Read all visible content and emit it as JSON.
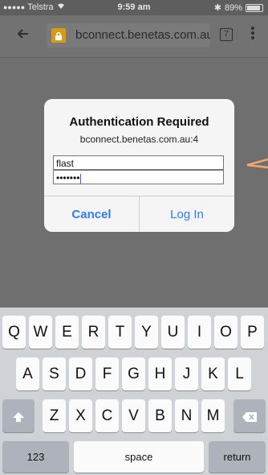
{
  "status_bar": {
    "signal": "●●●●●",
    "carrier": "Telstra",
    "time": "9:59 am",
    "battery_percent": "89%",
    "battery_level": 0.89
  },
  "browser": {
    "back_icon": "arrow-left-icon",
    "lock_icon": "lock-icon",
    "url": "bconnect.benetas.com.au",
    "tab_count": "7",
    "menu_icon": "more-vert-icon"
  },
  "dialog": {
    "title": "Authentication Required",
    "host": "bconnect.benetas.com.au:4",
    "username_value": "flast",
    "password_value": "•••••••",
    "cancel_label": "Cancel",
    "login_label": "Log In"
  },
  "keyboard": {
    "row1": [
      "Q",
      "W",
      "E",
      "R",
      "T",
      "Y",
      "U",
      "I",
      "O",
      "P"
    ],
    "row2": [
      "A",
      "S",
      "D",
      "F",
      "G",
      "H",
      "J",
      "K",
      "L"
    ],
    "row3": [
      "Z",
      "X",
      "C",
      "V",
      "B",
      "N",
      "M"
    ],
    "shift_icon": "shift-icon",
    "delete_icon": "backspace-icon",
    "numbers_label": "123",
    "space_label": "space",
    "return_label": "return"
  },
  "colors": {
    "accent": "#2e7cf6",
    "lock": "#d89b14",
    "arrow": "#f0a86a"
  }
}
